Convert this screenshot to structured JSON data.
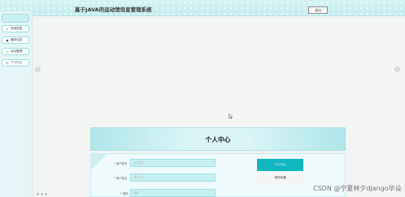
{
  "header": {
    "title": "基于JAVA的运动馆信息管理系统",
    "exit_label": "退出"
  },
  "sidebar": {
    "items": [
      {
        "label": "场馆信息",
        "icon": "home-icon"
      },
      {
        "label": "最新动态",
        "icon": "circle-icon"
      },
      {
        "label": "后台管理",
        "icon": "monitor-icon"
      },
      {
        "label": "个人中心",
        "icon": "person-icon"
      }
    ]
  },
  "carousel": {
    "prev_glyph": "‹",
    "next_glyph": "›"
  },
  "profile": {
    "title": "个人中心",
    "fields": [
      {
        "label": "用户账号",
        "placeholder": "用户账号"
      },
      {
        "label": "用户姓名",
        "placeholder": "用户姓名"
      },
      {
        "label": "密码",
        "placeholder": "密码"
      }
    ],
    "menu": [
      {
        "label": "个人中心"
      },
      {
        "label": "我的收藏"
      }
    ]
  },
  "watermark": "CSDN @宁夏林夕django毕设"
}
